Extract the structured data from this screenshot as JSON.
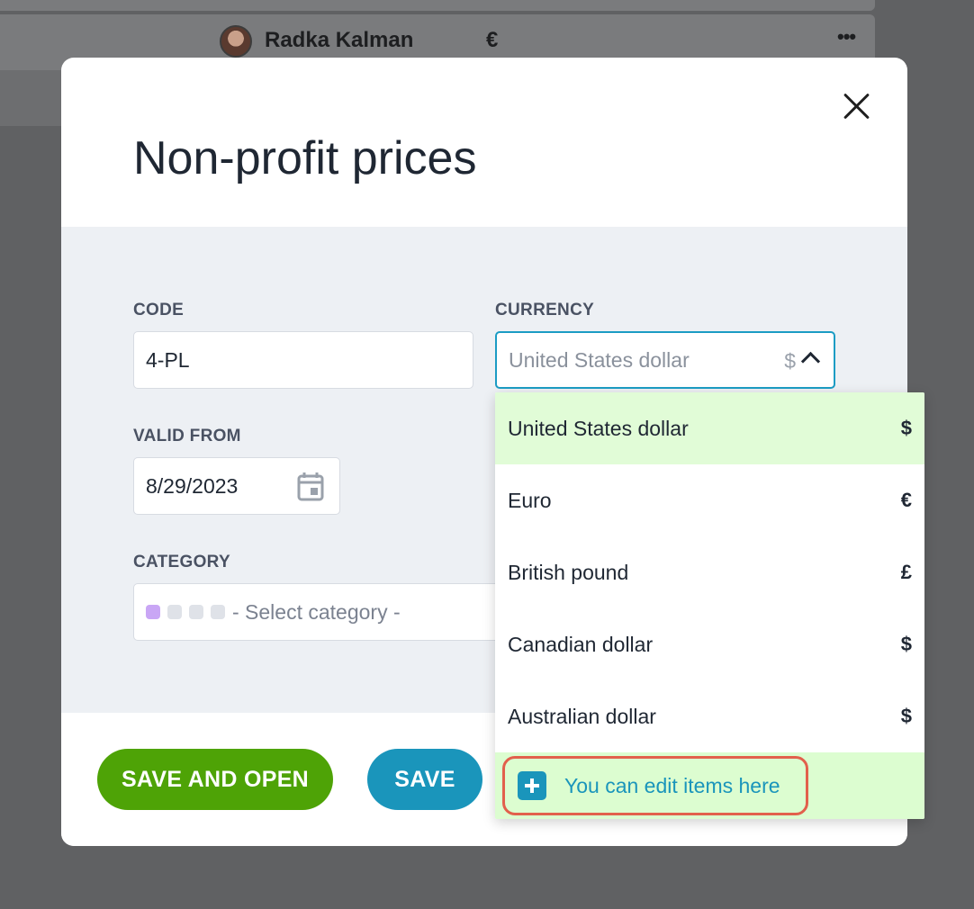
{
  "background": {
    "row_name": "Radka Kalman",
    "row_currency": "€",
    "row_more": "•••"
  },
  "modal": {
    "title": "Non-profit prices"
  },
  "form": {
    "code_label": "CODE",
    "code_value": "4-PL",
    "currency_label": "CURRENCY",
    "currency_value": "United States dollar",
    "currency_symbol": "$",
    "valid_from_label": "VALID FROM",
    "valid_from_value": "8/29/2023",
    "category_label": "CATEGORY",
    "category_placeholder": "- Select category -"
  },
  "dropdown": {
    "options": [
      {
        "label": "United States dollar",
        "symbol": "$",
        "selected": true
      },
      {
        "label": "Euro",
        "symbol": "€",
        "selected": false
      },
      {
        "label": "British pound",
        "symbol": "£",
        "selected": false
      },
      {
        "label": "Canadian dollar",
        "symbol": "$",
        "selected": false
      },
      {
        "label": "Australian dollar",
        "symbol": "$",
        "selected": false
      }
    ],
    "edit_link": "You can edit items here"
  },
  "footer": {
    "save_and_open": "SAVE AND OPEN",
    "save": "SAVE"
  },
  "colors": {
    "accent": "#1a95bb",
    "primary_green": "#4ea306",
    "selected_option_bg": "#e1fcd7",
    "highlight_border": "#e2604c"
  }
}
